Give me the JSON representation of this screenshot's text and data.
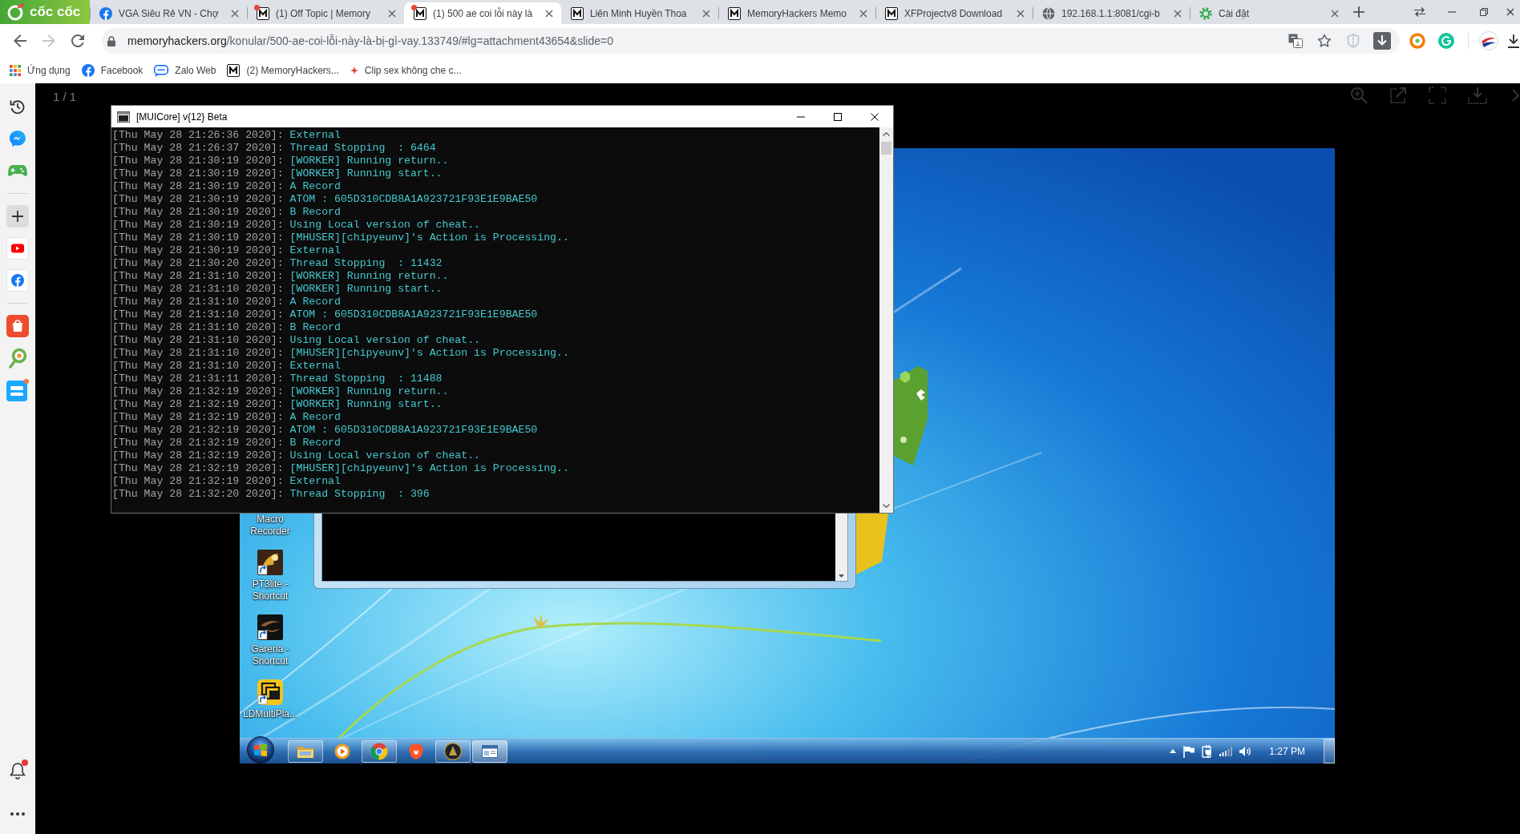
{
  "browser": {
    "brand": "cốc cốc",
    "tabs": [
      {
        "title": "VGA Siêu Rẻ VN - Chợ",
        "kind": "social",
        "badge": false,
        "selected": false
      },
      {
        "title": "(1) Off Topic | Memory",
        "kind": "forum",
        "badge": true,
        "selected": false
      },
      {
        "title": "(1) 500 ae coi lỗi này là",
        "kind": "forum",
        "badge": true,
        "selected": true
      },
      {
        "title": "Liên Minh Huyền Thoa",
        "kind": "forum",
        "badge": false,
        "selected": false
      },
      {
        "title": "MemoryHackers Memo",
        "kind": "forum",
        "badge": false,
        "selected": false
      },
      {
        "title": "XFProjectv8 Download",
        "kind": "forum",
        "badge": false,
        "selected": false
      },
      {
        "title": "192.168.1.1:8081/cgi-b",
        "kind": "web",
        "badge": false,
        "selected": false
      },
      {
        "title": "Cài đặt",
        "kind": "settings",
        "badge": false,
        "selected": false
      }
    ],
    "forward_enabled": false,
    "address": {
      "host": "memoryhackers.org",
      "path": "/konular/500-ae-coi-lỗi-này-là-bị-gì-vay.133749/#lg=attachment43654&slide=0"
    },
    "bookmarks": [
      {
        "label": "Ứng dụng",
        "kind": "apps"
      },
      {
        "label": "Facebook",
        "kind": "social"
      },
      {
        "label": "Zalo Web",
        "kind": "chat"
      },
      {
        "label": "(2) MemoryHackers...",
        "kind": "forum"
      },
      {
        "label": "Clip sex không che c...",
        "kind": "video"
      }
    ]
  },
  "sidebar": {
    "groups": [
      {
        "items": [
          {
            "kind": "history"
          },
          {
            "kind": "messenger"
          },
          {
            "kind": "games"
          }
        ]
      },
      {
        "items": [
          {
            "kind": "add"
          },
          {
            "kind": "video"
          },
          {
            "kind": "social"
          }
        ]
      },
      {
        "items": [
          {
            "kind": "shop"
          },
          {
            "kind": "map"
          },
          {
            "kind": "deals"
          }
        ]
      }
    ],
    "notification_badge": true
  },
  "viewer": {
    "counter": "1 / 1",
    "tools": [
      {
        "kind": "zoom"
      },
      {
        "kind": "share"
      },
      {
        "kind": "fullscreen"
      },
      {
        "kind": "download"
      },
      {
        "kind": "next"
      }
    ]
  },
  "console": {
    "title": "[MUICore] v{12} Beta",
    "lines": [
      {
        "timestamp": "[Thu May 28 21:26:36 2020]:",
        "message": "External"
      },
      {
        "timestamp": "[Thu May 28 21:26:37 2020]:",
        "message": "Thread Stopping  : 6464"
      },
      {
        "timestamp": "[Thu May 28 21:30:19 2020]:",
        "message": "[WORKER] Running return.."
      },
      {
        "timestamp": "[Thu May 28 21:30:19 2020]:",
        "message": "[WORKER] Running start.."
      },
      {
        "timestamp": "[Thu May 28 21:30:19 2020]:",
        "message": "A Record"
      },
      {
        "timestamp": "[Thu May 28 21:30:19 2020]:",
        "message": "ATOM : 605D310CDB8A1A923721F93E1E9BAE50"
      },
      {
        "timestamp": "[Thu May 28 21:30:19 2020]:",
        "message": "B Record"
      },
      {
        "timestamp": "[Thu May 28 21:30:19 2020]:",
        "message": "Using Local version of cheat.."
      },
      {
        "timestamp": "[Thu May 28 21:30:19 2020]:",
        "message": "[MHUSER][chipyeunv]'s Action is Processing.."
      },
      {
        "timestamp": "[Thu May 28 21:30:19 2020]:",
        "message": "External"
      },
      {
        "timestamp": "[Thu May 28 21:30:20 2020]:",
        "message": "Thread Stopping  : 11432"
      },
      {
        "timestamp": "[Thu May 28 21:31:10 2020]:",
        "message": "[WORKER] Running return.."
      },
      {
        "timestamp": "[Thu May 28 21:31:10 2020]:",
        "message": "[WORKER] Running start.."
      },
      {
        "timestamp": "[Thu May 28 21:31:10 2020]:",
        "message": "A Record"
      },
      {
        "timestamp": "[Thu May 28 21:31:10 2020]:",
        "message": "ATOM : 605D310CDB8A1A923721F93E1E9BAE50"
      },
      {
        "timestamp": "[Thu May 28 21:31:10 2020]:",
        "message": "B Record"
      },
      {
        "timestamp": "[Thu May 28 21:31:10 2020]:",
        "message": "Using Local version of cheat.."
      },
      {
        "timestamp": "[Thu May 28 21:31:10 2020]:",
        "message": "[MHUSER][chipyeunv]'s Action is Processing.."
      },
      {
        "timestamp": "[Thu May 28 21:31:10 2020]:",
        "message": "External"
      },
      {
        "timestamp": "[Thu May 28 21:31:11 2020]:",
        "message": "Thread Stopping  : 11488"
      },
      {
        "timestamp": "[Thu May 28 21:32:19 2020]:",
        "message": "[WORKER] Running return.."
      },
      {
        "timestamp": "[Thu May 28 21:32:19 2020]:",
        "message": "[WORKER] Running start.."
      },
      {
        "timestamp": "[Thu May 28 21:32:19 2020]:",
        "message": "A Record"
      },
      {
        "timestamp": "[Thu May 28 21:32:19 2020]:",
        "message": "ATOM : 605D310CDB8A1A923721F93E1E9BAE50"
      },
      {
        "timestamp": "[Thu May 28 21:32:19 2020]:",
        "message": "B Record"
      },
      {
        "timestamp": "[Thu May 28 21:32:19 2020]:",
        "message": "Using Local version of cheat.."
      },
      {
        "timestamp": "[Thu May 28 21:32:19 2020]:",
        "message": "[MHUSER][chipyeunv]'s Action is Processing.."
      },
      {
        "timestamp": "[Thu May 28 21:32:19 2020]:",
        "message": "External"
      },
      {
        "timestamp": "[Thu May 28 21:32:20 2020]:",
        "message": "Thread Stopping  : 396"
      }
    ]
  },
  "desktop": {
    "icons": [
      {
        "label": "Macro Recorder",
        "kind": "covered"
      },
      {
        "label": "PT3lite - Shortcut",
        "kind": "portrait"
      },
      {
        "label": "Garena - Shortcut",
        "kind": "swoosh"
      },
      {
        "label": "LDMultiPla...",
        "kind": "stack"
      }
    ],
    "taskbar": {
      "pinned": [
        {
          "kind": "folder",
          "running": true,
          "active": false
        },
        {
          "kind": "media",
          "running": false,
          "active": false
        },
        {
          "kind": "browser",
          "running": true,
          "active": false
        },
        {
          "kind": "lion",
          "running": false,
          "active": false
        },
        {
          "kind": "game",
          "running": true,
          "active": false
        },
        {
          "kind": "window",
          "running": true,
          "active": true
        }
      ],
      "tray": [
        {
          "kind": "caret"
        },
        {
          "kind": "flag"
        },
        {
          "kind": "power"
        },
        {
          "kind": "signal"
        },
        {
          "kind": "volume"
        }
      ],
      "clock": "1:27 PM"
    }
  }
}
